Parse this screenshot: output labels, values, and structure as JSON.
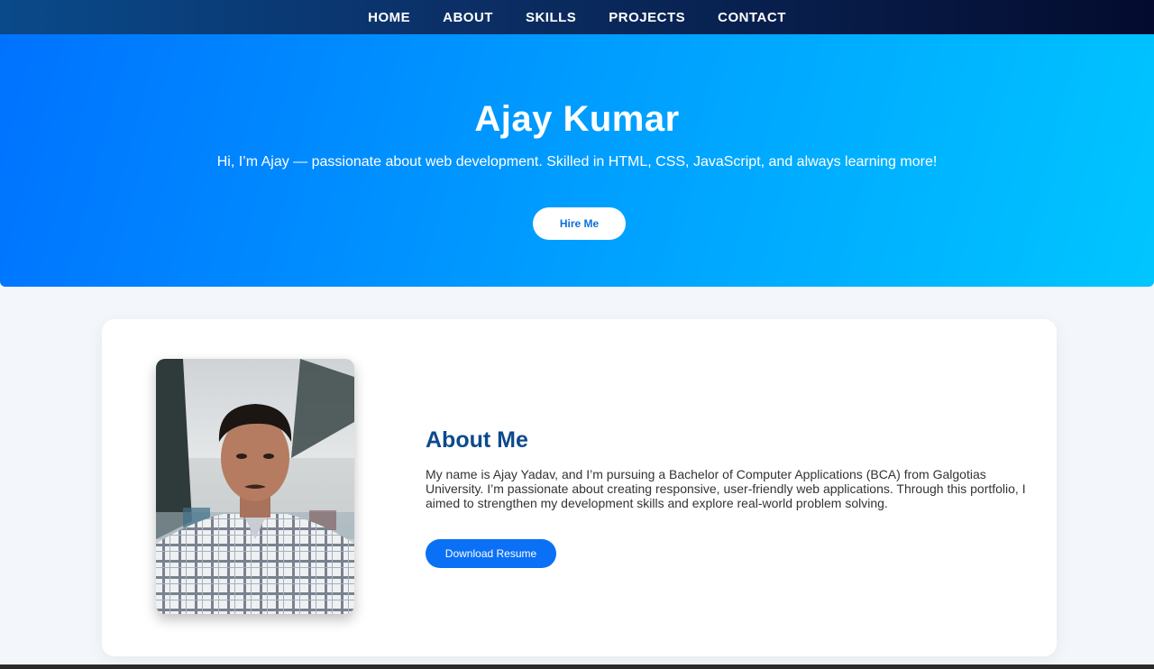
{
  "nav": {
    "items": [
      {
        "label": "HOME"
      },
      {
        "label": "ABOUT"
      },
      {
        "label": "SKILLS"
      },
      {
        "label": "PROJECTS"
      },
      {
        "label": "CONTACT"
      }
    ]
  },
  "hero": {
    "title": "Ajay Kumar",
    "subtitle": "Hi, I’m Ajay — passionate about web development. Skilled in HTML, CSS, JavaScript, and always learning more!",
    "button_label": "Hire Me"
  },
  "about": {
    "title": "About Me",
    "text": "My name is Ajay Yadav, and I’m pursuing a Bachelor of Computer Applications (BCA) from Galgotias University. I’m passionate about creating responsive, user-friendly web applications. Through this portfolio, I aimed to strengthen my development skills and explore real-world problem solving.",
    "button_label": "Download Resume"
  },
  "colors": {
    "nav_bg": "#0b2f66",
    "hero_start": "#0072ff",
    "hero_end": "#00c6ff",
    "about_title": "#0d4a8c",
    "button_blue": "#0a70f5"
  }
}
